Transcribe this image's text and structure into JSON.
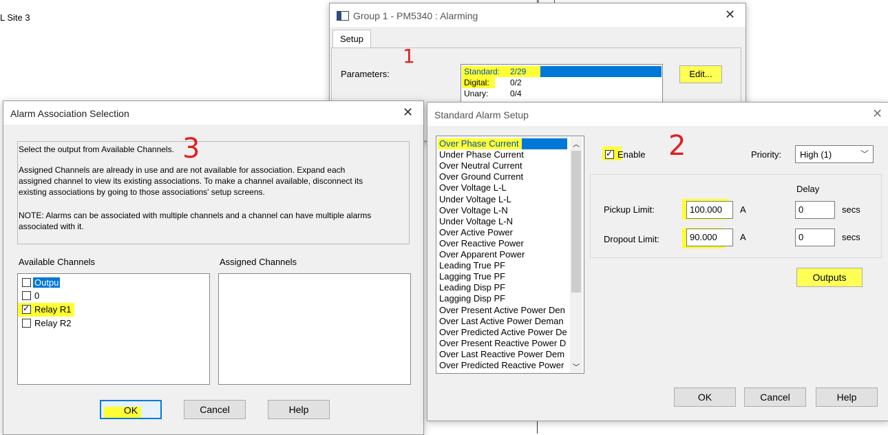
{
  "background": {
    "site_label": "L Site 3"
  },
  "alarming_window": {
    "title": "Group 1 - PM5340 : Alarming",
    "tab_setup": "Setup",
    "parameters_label": "Parameters:",
    "params": [
      {
        "name": "Standard:",
        "value": "2/29"
      },
      {
        "name": "Digital:",
        "value": "0/2"
      },
      {
        "name": "Unary:",
        "value": "0/4"
      }
    ],
    "edit_button": "Edit...",
    "annotation": "1"
  },
  "association_window": {
    "title": "Alarm Association Selection",
    "info_line1": "Select the output from Available Channels.",
    "info_line2": "Assigned Channels are already in use and are not available for association.  Expand each",
    "info_line3": "assigned channel to view its existing associations.  To make a channel available, disconnect its",
    "info_line4": "existing associations by going to those associations' setup screens.",
    "info_line5": "NOTE: Alarms can be associated with multiple channels and a channel can have multiple alarms",
    "info_line6": "associated with it.",
    "available_label": "Available Channels",
    "assigned_label": "Assigned Channels",
    "channels": [
      {
        "label": "Outpu",
        "checked": false
      },
      {
        "label": "0",
        "checked": false
      },
      {
        "label": "Relay R1",
        "checked": true
      },
      {
        "label": "Relay R2",
        "checked": false
      }
    ],
    "ok_button": "OK",
    "cancel_button": "Cancel",
    "help_button": "Help",
    "annotation": "3"
  },
  "standard_window": {
    "title": "Standard Alarm Setup",
    "alarms": [
      "Over Phase Current",
      "Under Phase Current",
      "Over Neutral Current",
      "Over Ground Current",
      "Over Voltage L-L",
      "Under Voltage L-L",
      "Over Voltage L-N",
      "Under Voltage L-N",
      "Over Active Power",
      "Over Reactive Power",
      "Over Apparent Power",
      "Leading True PF",
      "Lagging True PF",
      "Leading Disp PF",
      "Lagging Disp PF",
      "Over Present Active Power Den",
      "Over Last Active Power Deman",
      "Over Predicted Active Power De",
      "Over Present Reactive Power D",
      "Over Last Reactive Power Dem",
      "Over Predicted Reactive Power"
    ],
    "enable_label": "Enable",
    "enable_checked": true,
    "priority_label": "Priority:",
    "priority_value": "High (1)",
    "delay_label": "Delay",
    "pickup_label": "Pickup Limit:",
    "pickup_value": "100.000",
    "pickup_unit": "A",
    "pickup_delay": "0",
    "pickup_delay_unit": "secs",
    "dropout_label": "Dropout Limit:",
    "dropout_value": "90.000",
    "dropout_unit": "A",
    "dropout_delay": "0",
    "dropout_delay_unit": "secs",
    "outputs_button": "Outputs",
    "ok_button": "OK",
    "cancel_button": "Cancel",
    "help_button": "Help",
    "annotation": "2"
  },
  "colors": {
    "highlight": "#ffff33",
    "selection": "#0078d7",
    "annotation_red": "#e02020"
  }
}
